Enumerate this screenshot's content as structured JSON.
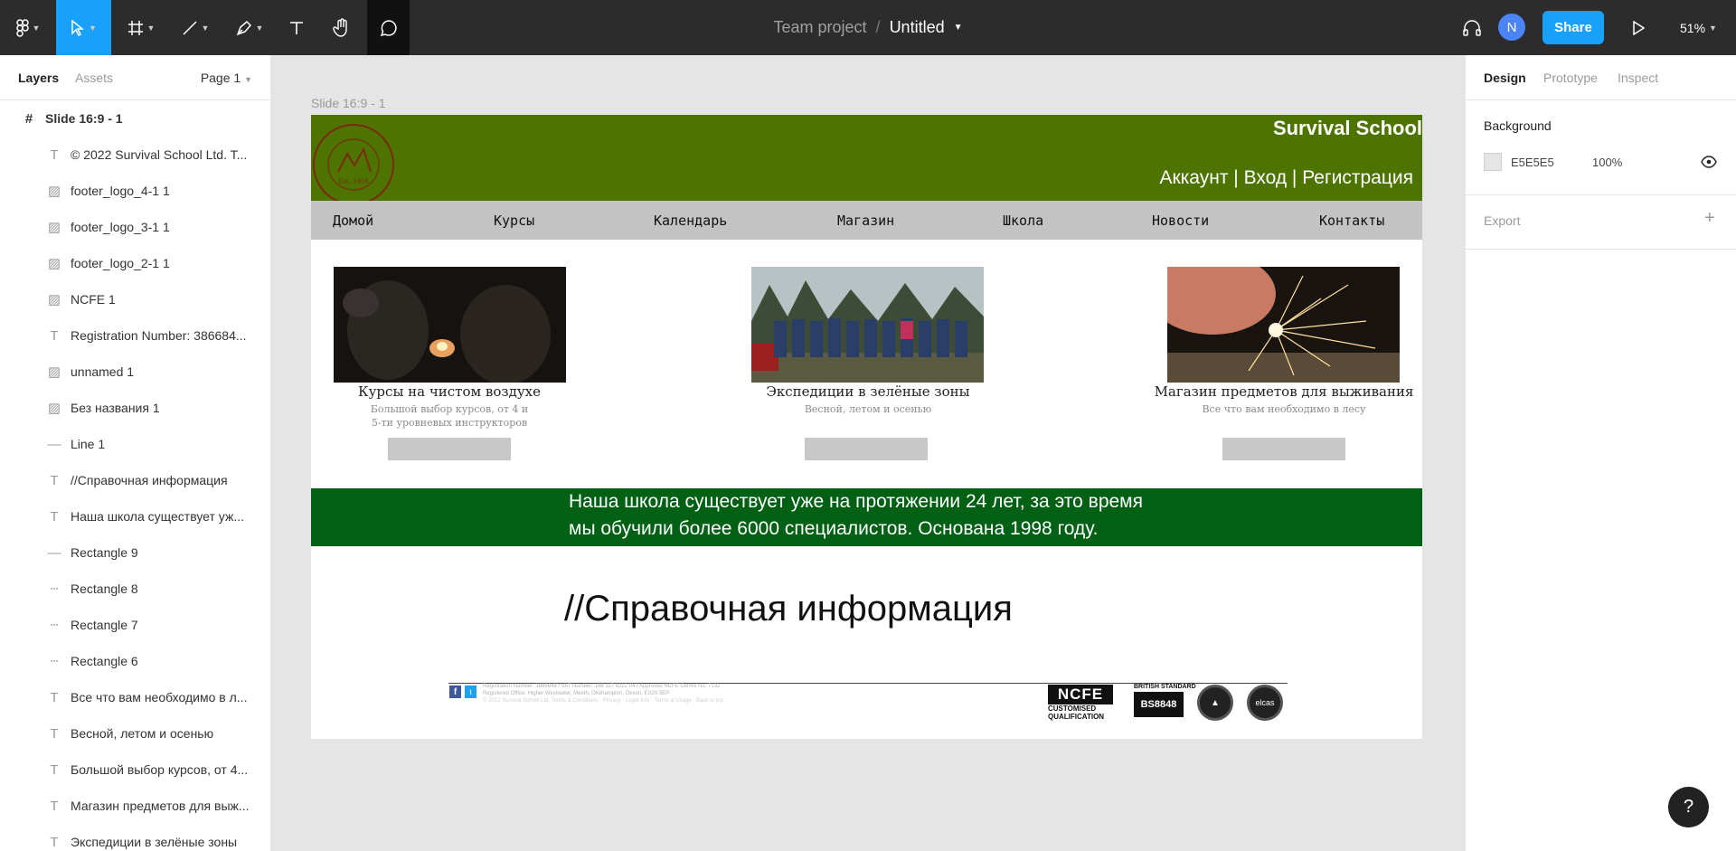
{
  "toolbar": {
    "team": "Team project",
    "separator": "/",
    "file_name": "Untitled",
    "avatar_initial": "N",
    "share_label": "Share",
    "zoom": "51%",
    "accent": "#18a0fb"
  },
  "left_panel": {
    "tabs": [
      "Layers",
      "Assets"
    ],
    "page": "Page 1",
    "frame": "Slide 16:9 - 1",
    "layers": [
      {
        "icon": "text-icon",
        "label": "© 2022 Survival School Ltd. T..."
      },
      {
        "icon": "image-icon",
        "label": "footer_logo_4-1 1"
      },
      {
        "icon": "image-icon",
        "label": "footer_logo_3-1 1"
      },
      {
        "icon": "image-icon",
        "label": "footer_logo_2-1 1"
      },
      {
        "icon": "image-icon",
        "label": "NCFE 1"
      },
      {
        "icon": "text-icon",
        "label": "Registration Number: 386684..."
      },
      {
        "icon": "image-icon",
        "label": "unnamed 1"
      },
      {
        "icon": "image-icon",
        "label": "Без названия 1"
      },
      {
        "icon": "line-icon",
        "label": "Line 1"
      },
      {
        "icon": "text-icon",
        "label": "//Справочная информация"
      },
      {
        "icon": "text-icon",
        "label": "Наша школа существует уж..."
      },
      {
        "icon": "line-icon",
        "label": "Rectangle 9"
      },
      {
        "icon": "dashed-rect-icon",
        "label": "Rectangle 8"
      },
      {
        "icon": "dashed-rect-icon",
        "label": "Rectangle 7"
      },
      {
        "icon": "dashed-rect-icon",
        "label": "Rectangle 6"
      },
      {
        "icon": "text-icon",
        "label": "Все что вам необходимо в л..."
      },
      {
        "icon": "text-icon",
        "label": "Весной, летом и осенью"
      },
      {
        "icon": "text-icon",
        "label": "Большой выбор курсов, от 4..."
      },
      {
        "icon": "text-icon",
        "label": "Магазин предметов для выж..."
      },
      {
        "icon": "text-icon",
        "label": "Экспедиции в зелёные зоны"
      }
    ]
  },
  "right_panel": {
    "tabs": [
      "Design",
      "Prototype",
      "Inspect"
    ],
    "background_label": "Background",
    "background_hex": "E5E5E5",
    "background_opacity": "100%",
    "export_label": "Export"
  },
  "canvas": {
    "frame_label": "Slide 16:9 - 1",
    "site": {
      "logo_text": "BOULDER OUTDOOR SURVIVAL SCHOOL",
      "logo_est": "Est. 1968",
      "title": "Survival School",
      "account_links": "Аккаунт | Вход | Регистрация",
      "header_color": "#4e7400",
      "nav": [
        "Домой",
        "Курсы",
        "Календарь",
        "Магазин",
        "Школа",
        "Новости",
        "Контакты"
      ],
      "cards": [
        {
          "title": "Курсы на чистом воздухе",
          "sub1": "Большой выбор курсов, от 4 и",
          "sub2": "5-ти уровневых инструкторов"
        },
        {
          "title": "Экспедиции в зелёные зоны",
          "sub1": "Весной, летом и осенью",
          "sub2": ""
        },
        {
          "title": "Магазин предметов для выживания",
          "sub1": "Все что вам необходимо в лесу",
          "sub2": ""
        }
      ],
      "banner_line1": "Наша школа существует уже на протяжении 24 лет, за это время",
      "banner_line2": "мы обучили более 6000 специалистов. Основана 1998 году.",
      "banner_color": "#006014",
      "info_heading": "//Справочная информация",
      "footer": {
        "reg_line1": "Registration Number: 3866848 / VAT Number: 188 117 8222 04 / Approved NCFE Centre No. 7132",
        "reg_line2": "Registered Office: Higher Westwater, Meeth, Okehampton, Devon, EX20 3EP",
        "copyright": "© 2022 Survival School Ltd. Terms & Conditions · Privacy · Legal Info · Terms & Usage · Back to top",
        "facebook": "f",
        "twitter": "t",
        "ncfe": "NCFE",
        "ncfe_sub1": "CUSTOMISED",
        "ncfe_sub2": "QUALIFICATION",
        "bs_top": "BRITISH STANDARD",
        "bs_code": "BS8848",
        "logo3": "▲",
        "logo4": "elcas"
      }
    }
  }
}
